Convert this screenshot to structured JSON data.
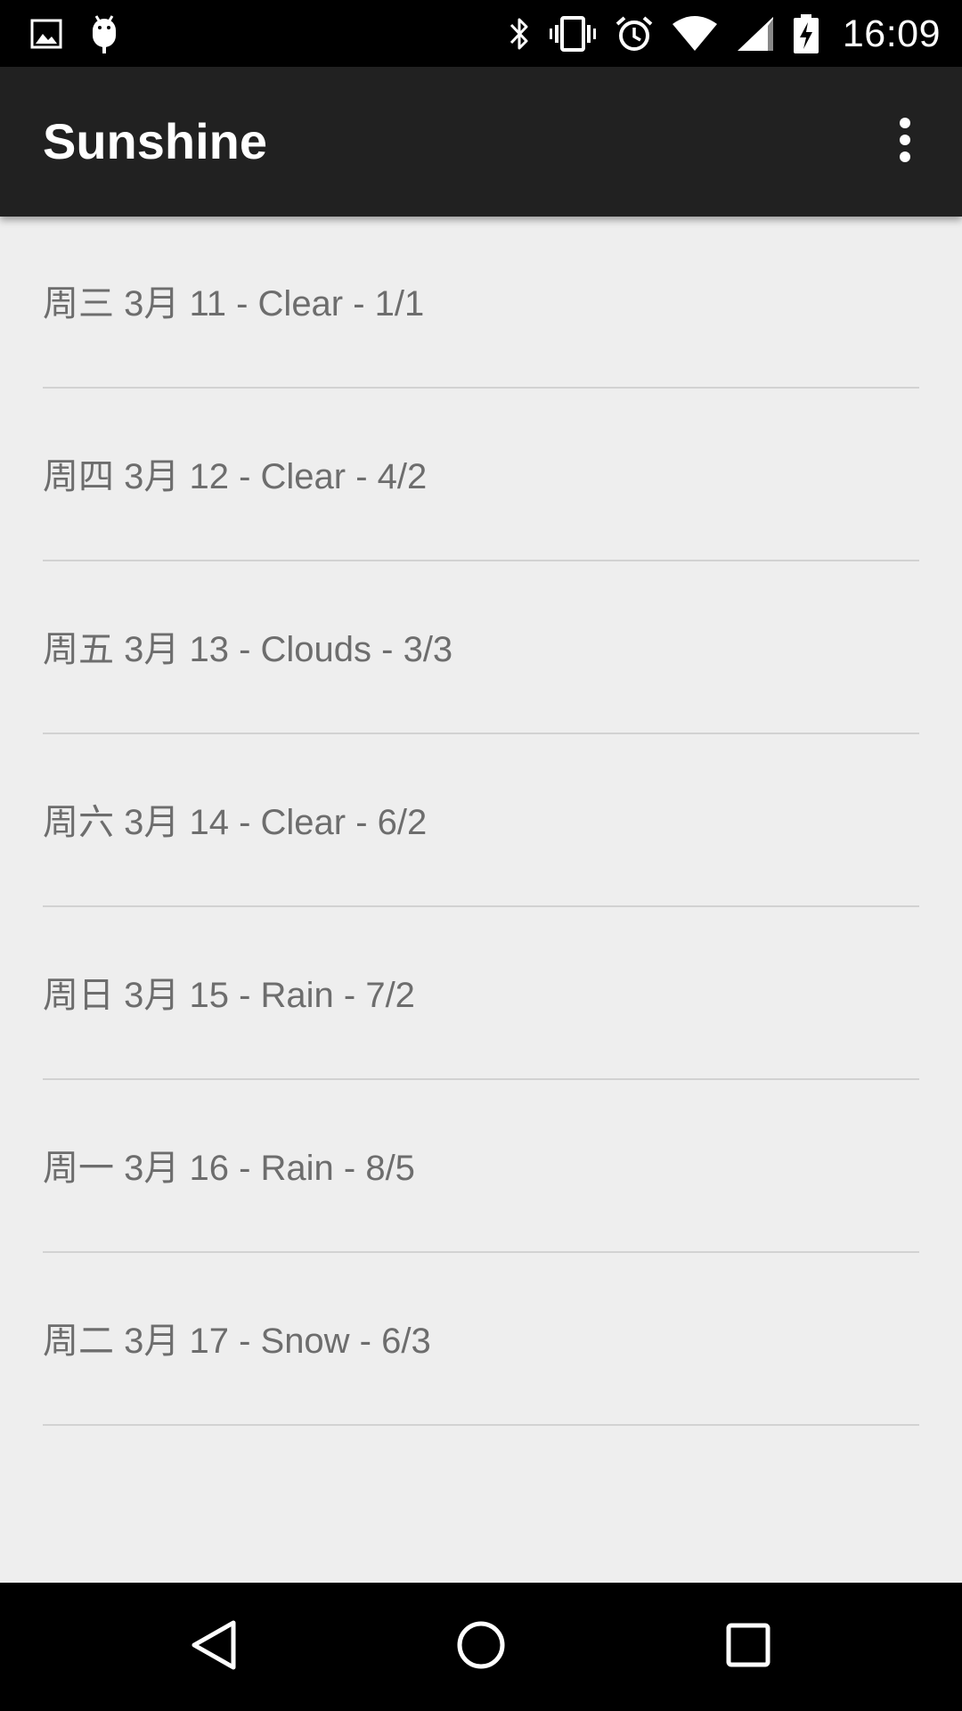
{
  "status_bar": {
    "time": "16:09",
    "left_icons": [
      "picture-icon",
      "android-debug-icon"
    ],
    "right_icons": [
      "bluetooth-icon",
      "vibrate-icon",
      "alarm-icon",
      "wifi-icon",
      "cell-signal-icon",
      "battery-charging-icon"
    ]
  },
  "app_bar": {
    "title": "Sunshine",
    "overflow_icon": "overflow-menu-icon"
  },
  "forecast": [
    {
      "label": "周三 3月 11 - Clear - 1/1"
    },
    {
      "label": "周四 3月 12 - Clear - 4/2"
    },
    {
      "label": "周五 3月 13 - Clouds - 3/3"
    },
    {
      "label": "周六 3月 14 - Clear - 6/2"
    },
    {
      "label": "周日 3月 15 - Rain - 7/2"
    },
    {
      "label": "周一 3月 16 - Rain - 8/5"
    },
    {
      "label": "周二 3月 17 - Snow - 6/3"
    }
  ],
  "nav_bar": {
    "buttons": [
      "back-icon",
      "home-icon",
      "recents-icon"
    ]
  },
  "colors": {
    "status_bar": "#000000",
    "app_bar": "#212121",
    "background": "#eeeeee",
    "item_text": "#6d6d6d",
    "divider": "#d2d2d2"
  }
}
